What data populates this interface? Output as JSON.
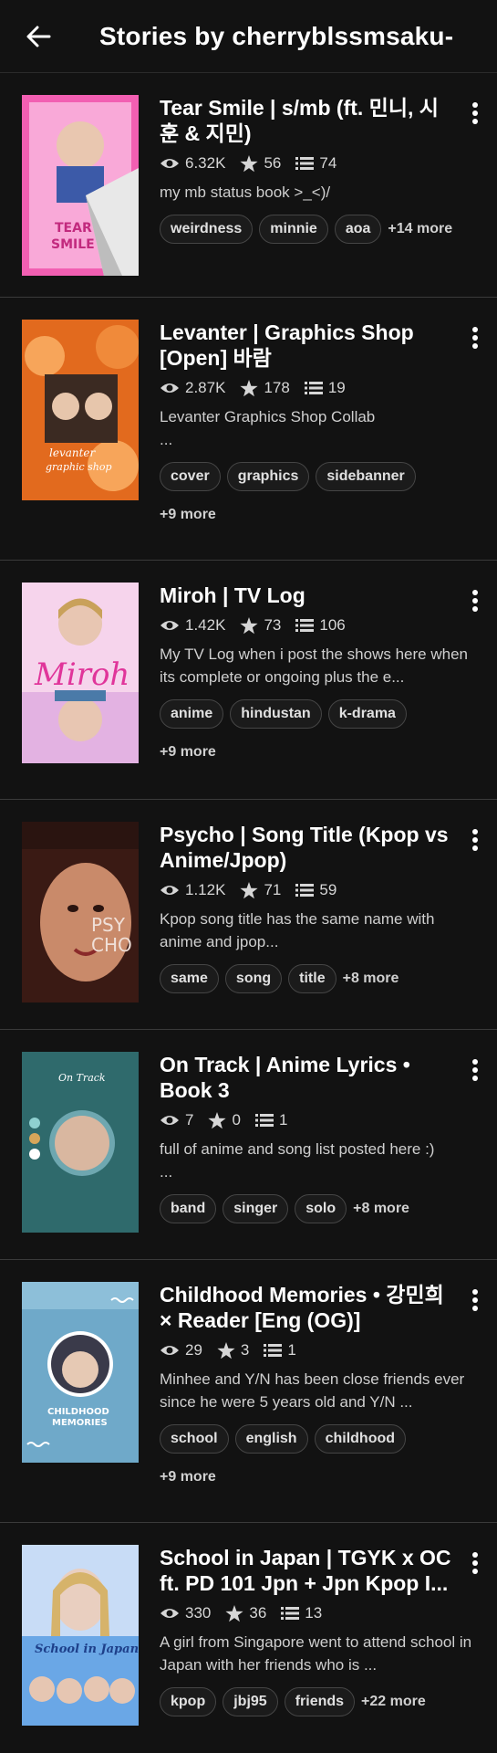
{
  "header": {
    "title": "Stories by cherryblssmsaku-"
  },
  "stories": [
    {
      "title": "Tear Smile | s/mb (ft. 민니, 시훈 & 지민)",
      "reads": "6.32K",
      "votes": "56",
      "parts": "74",
      "description": "my mb status book >_<)/",
      "tags": [
        "weirdness",
        "minnie",
        "aoa"
      ],
      "more": "+14 more",
      "cover_colors": [
        "#f25fb2",
        "#f9a9d8"
      ]
    },
    {
      "title": "Levanter | Graphics Shop [Open] 바람",
      "reads": "2.87K",
      "votes": "178",
      "parts": "19",
      "description": "Levanter Graphics Shop Collab\n...",
      "tags": [
        "cover",
        "graphics",
        "sidebanner"
      ],
      "more": "+9 more",
      "cover_colors": [
        "#e26a1e",
        "#f7a55a"
      ]
    },
    {
      "title": "Miroh | TV Log",
      "reads": "1.42K",
      "votes": "73",
      "parts": "106",
      "description": "My TV Log when i post the shows here when its complete or ongoing plus the e...",
      "tags": [
        "anime",
        "hindustan",
        "k-drama"
      ],
      "more": "+9 more",
      "cover_colors": [
        "#f6d4ec",
        "#cf8fd8"
      ]
    },
    {
      "title": "Psycho | Song Title (Kpop vs Anime/Jpop)",
      "reads": "1.12K",
      "votes": "71",
      "parts": "59",
      "description": "Kpop song title has the same name with anime and jpop...",
      "tags": [
        "same",
        "song",
        "title"
      ],
      "more": "+8 more",
      "cover_colors": [
        "#3a1a14",
        "#c98a6a"
      ]
    },
    {
      "title": "On Track | Anime Lyrics • Book 3",
      "reads": "7",
      "votes": "0",
      "parts": "1",
      "description": "full of anime and song list posted here :)\n...",
      "tags": [
        "band",
        "singer",
        "solo"
      ],
      "more": "+8 more",
      "cover_colors": [
        "#2f6a6c",
        "#3f7c7e"
      ]
    },
    {
      "title": "Childhood Memories • 강민희 × Reader [Eng (OG)]",
      "reads": "29",
      "votes": "3",
      "parts": "1",
      "description": "Minhee and Y/N has been close friends ever since he were 5 years old and Y/N ...",
      "tags": [
        "school",
        "english",
        "childhood"
      ],
      "more": "+9 more",
      "cover_colors": [
        "#6fa9c9",
        "#8dbfd9"
      ]
    },
    {
      "title": "School in Japan | TGYK x OC ft. PD 101 Jpn + Jpn Kpop I...",
      "reads": "330",
      "votes": "36",
      "parts": "13",
      "description": "A girl from Singapore went to attend school in Japan with her friends who is ...",
      "tags": [
        "kpop",
        "jbj95",
        "friends"
      ],
      "more": "+22 more",
      "cover_colors": [
        "#6aa7e6",
        "#c8dcf6"
      ]
    }
  ]
}
